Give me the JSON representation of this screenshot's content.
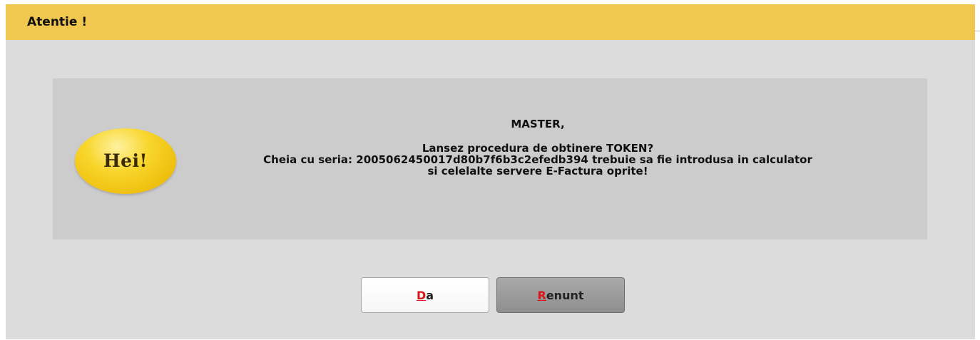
{
  "dialog": {
    "title": "Atentie !",
    "badge_text": "Hei!",
    "message": {
      "heading": "MASTER,",
      "line1": "Lansez procedura de obtinere TOKEN?",
      "line2": "Cheia cu seria: 2005062450017d80b7f6b3c2efedb394 trebuie sa fie introdusa in calculator",
      "line3": "si celelalte servere E-Factura oprite!"
    },
    "buttons": {
      "da": {
        "mnemonic": "D",
        "rest": "a"
      },
      "renunt": {
        "mnemonic": "R",
        "rest": "enunt"
      }
    }
  },
  "colors": {
    "titlebar": "#f0c850",
    "dialog_bg": "#dcdcdc",
    "panel_bg": "#cccccc",
    "badge": "#f2c81e",
    "mnemonic": "#d81818",
    "primary_button": "#ffffff",
    "secondary_button": "#9c9c9c"
  },
  "icons": {
    "badge": "hei-badge-icon"
  }
}
